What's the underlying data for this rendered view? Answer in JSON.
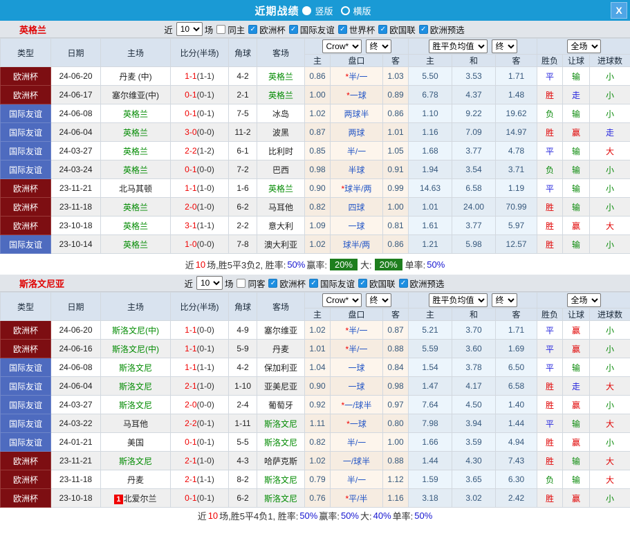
{
  "titlebar": {
    "title": "近期战绩",
    "vertical_label": "竖版",
    "horizontal_label": "横版",
    "close_label": "X",
    "bar_color": "#1a9ad5"
  },
  "columns": {
    "top": [
      "类型",
      "日期",
      "主场",
      "比分(半场)",
      "角球",
      "客场"
    ],
    "selects": {
      "crow": "Crow*",
      "final": "终",
      "avg": "胜平负均值",
      "scope": "全场"
    },
    "sub": [
      "主",
      "盘口",
      "客",
      "主",
      "和",
      "客",
      "胜负",
      "让球",
      "进球数"
    ]
  },
  "colors": {
    "euro_cup_bg": "#7d0e12",
    "friendly_bg": "#4e6bbf",
    "focus_team": "#008a00",
    "win": "#e00000",
    "draw": "#2424dd",
    "lose": "#0a8a0a"
  },
  "sections": [
    {
      "team": "英格兰",
      "filter": {
        "near": "近",
        "count": "10",
        "games": "场",
        "same": "同主",
        "same_checked": false,
        "leagues": [
          {
            "label": "欧洲杯",
            "checked": true
          },
          {
            "label": "国际友谊",
            "checked": true
          },
          {
            "label": "世界杯",
            "checked": true
          },
          {
            "label": "欧国联",
            "checked": true
          },
          {
            "label": "欧洲预选",
            "checked": true
          }
        ]
      },
      "rows": [
        {
          "type": "欧洲杯",
          "cat": "euro",
          "date": "24-06-20",
          "home": "丹麦 (中)",
          "home_focus": false,
          "home_badge": "",
          "score": "1-1",
          "half": "(1-1)",
          "corner": "4-2",
          "away": "英格兰",
          "away_focus": true,
          "c_home": "0.86",
          "star": true,
          "handicap": "半/一",
          "c_away": "1.03",
          "o_home": "5.50",
          "o_draw": "3.53",
          "o_away": "1.71",
          "res": "平",
          "let": "输",
          "goal": "小"
        },
        {
          "type": "欧洲杯",
          "cat": "euro",
          "date": "24-06-17",
          "home": "塞尔维亚(中)",
          "home_focus": false,
          "home_badge": "",
          "score": "0-1",
          "half": "(0-1)",
          "corner": "2-1",
          "away": "英格兰",
          "away_focus": true,
          "c_home": "1.00",
          "star": true,
          "handicap": "一球",
          "c_away": "0.89",
          "o_home": "6.78",
          "o_draw": "4.37",
          "o_away": "1.48",
          "res": "胜",
          "let": "走",
          "goal": "小"
        },
        {
          "type": "国际友谊",
          "cat": "friendly",
          "date": "24-06-08",
          "home": "英格兰",
          "home_focus": true,
          "home_badge": "",
          "score": "0-1",
          "half": "(0-1)",
          "corner": "7-5",
          "away": "冰岛",
          "away_focus": false,
          "c_home": "1.02",
          "star": false,
          "handicap": "两球半",
          "c_away": "0.86",
          "o_home": "1.10",
          "o_draw": "9.22",
          "o_away": "19.62",
          "res": "负",
          "let": "输",
          "goal": "小"
        },
        {
          "type": "国际友谊",
          "cat": "friendly",
          "date": "24-06-04",
          "home": "英格兰",
          "home_focus": true,
          "home_badge": "",
          "score": "3-0",
          "half": "(0-0)",
          "corner": "11-2",
          "away": "波黑",
          "away_focus": false,
          "c_home": "0.87",
          "star": false,
          "handicap": "两球",
          "c_away": "1.01",
          "o_home": "1.16",
          "o_draw": "7.09",
          "o_away": "14.97",
          "res": "胜",
          "let": "赢",
          "goal": "走"
        },
        {
          "type": "国际友谊",
          "cat": "friendly",
          "date": "24-03-27",
          "home": "英格兰",
          "home_focus": true,
          "home_badge": "",
          "score": "2-2",
          "half": "(1-2)",
          "corner": "6-1",
          "away": "比利时",
          "away_focus": false,
          "c_home": "0.85",
          "star": false,
          "handicap": "半/一",
          "c_away": "1.05",
          "o_home": "1.68",
          "o_draw": "3.77",
          "o_away": "4.78",
          "res": "平",
          "let": "输",
          "goal": "大"
        },
        {
          "type": "国际友谊",
          "cat": "friendly",
          "date": "24-03-24",
          "home": "英格兰",
          "home_focus": true,
          "home_badge": "",
          "score": "0-1",
          "half": "(0-0)",
          "corner": "7-2",
          "away": "巴西",
          "away_focus": false,
          "c_home": "0.98",
          "star": false,
          "handicap": "半球",
          "c_away": "0.91",
          "o_home": "1.94",
          "o_draw": "3.54",
          "o_away": "3.71",
          "res": "负",
          "let": "输",
          "goal": "小"
        },
        {
          "type": "欧洲杯",
          "cat": "euro",
          "date": "23-11-21",
          "home": "北马其顿",
          "home_focus": false,
          "home_badge": "",
          "score": "1-1",
          "half": "(1-0)",
          "corner": "1-6",
          "away": "英格兰",
          "away_focus": true,
          "c_home": "0.90",
          "star": true,
          "handicap": "球半/两",
          "c_away": "0.99",
          "o_home": "14.63",
          "o_draw": "6.58",
          "o_away": "1.19",
          "res": "平",
          "let": "输",
          "goal": "小"
        },
        {
          "type": "欧洲杯",
          "cat": "euro",
          "date": "23-11-18",
          "home": "英格兰",
          "home_focus": true,
          "home_badge": "",
          "score": "2-0",
          "half": "(1-0)",
          "corner": "6-2",
          "away": "马耳他",
          "away_focus": false,
          "c_home": "0.82",
          "star": false,
          "handicap": "四球",
          "c_away": "1.00",
          "o_home": "1.01",
          "o_draw": "24.00",
          "o_away": "70.99",
          "res": "胜",
          "let": "输",
          "goal": "小"
        },
        {
          "type": "欧洲杯",
          "cat": "euro",
          "date": "23-10-18",
          "home": "英格兰",
          "home_focus": true,
          "home_badge": "",
          "score": "3-1",
          "half": "(1-1)",
          "corner": "2-2",
          "away": "意大利",
          "away_focus": false,
          "c_home": "1.09",
          "star": false,
          "handicap": "一球",
          "c_away": "0.81",
          "o_home": "1.61",
          "o_draw": "3.77",
          "o_away": "5.97",
          "res": "胜",
          "let": "赢",
          "goal": "大"
        },
        {
          "type": "国际友谊",
          "cat": "friendly",
          "date": "23-10-14",
          "home": "英格兰",
          "home_focus": true,
          "home_badge": "",
          "score": "1-0",
          "half": "(0-0)",
          "corner": "7-8",
          "away": "澳大利亚",
          "away_focus": false,
          "c_home": "1.02",
          "star": false,
          "handicap": "球半/两",
          "c_away": "0.86",
          "o_home": "1.21",
          "o_draw": "5.98",
          "o_away": "12.57",
          "res": "胜",
          "let": "输",
          "goal": "小"
        }
      ],
      "summary": [
        {
          "text": "近"
        },
        {
          "text": "10",
          "style": "red"
        },
        {
          "text": "场,胜5平3负2, 胜率:"
        },
        {
          "text": "50%",
          "style": "blue"
        },
        {
          "text": " 赢率:"
        },
        {
          "text": "20%",
          "style": "greenbox"
        },
        {
          "text": " 大:"
        },
        {
          "text": "20%",
          "style": "greenbox"
        },
        {
          "text": " 单率:"
        },
        {
          "text": "50%",
          "style": "blue"
        }
      ]
    },
    {
      "team": "斯洛文尼亚",
      "filter": {
        "near": "近",
        "count": "10",
        "games": "场",
        "same": "同客",
        "same_checked": false,
        "leagues": [
          {
            "label": "欧洲杯",
            "checked": true
          },
          {
            "label": "国际友谊",
            "checked": true
          },
          {
            "label": "欧国联",
            "checked": true
          },
          {
            "label": "欧洲预选",
            "checked": true
          }
        ]
      },
      "rows": [
        {
          "type": "欧洲杯",
          "cat": "euro",
          "date": "24-06-20",
          "home": "斯洛文尼(中)",
          "home_focus": true,
          "home_badge": "",
          "score": "1-1",
          "half": "(0-0)",
          "corner": "4-9",
          "away": "塞尔维亚",
          "away_focus": false,
          "c_home": "1.02",
          "star": true,
          "handicap": "半/一",
          "c_away": "0.87",
          "o_home": "5.21",
          "o_draw": "3.70",
          "o_away": "1.71",
          "res": "平",
          "let": "赢",
          "goal": "小"
        },
        {
          "type": "欧洲杯",
          "cat": "euro",
          "date": "24-06-16",
          "home": "斯洛文尼(中)",
          "home_focus": true,
          "home_badge": "",
          "score": "1-1",
          "half": "(0-1)",
          "corner": "5-9",
          "away": "丹麦",
          "away_focus": false,
          "c_home": "1.01",
          "star": true,
          "handicap": "半/一",
          "c_away": "0.88",
          "o_home": "5.59",
          "o_draw": "3.60",
          "o_away": "1.69",
          "res": "平",
          "let": "赢",
          "goal": "小"
        },
        {
          "type": "国际友谊",
          "cat": "friendly",
          "date": "24-06-08",
          "home": "斯洛文尼",
          "home_focus": true,
          "home_badge": "",
          "score": "1-1",
          "half": "(1-1)",
          "corner": "4-2",
          "away": "保加利亚",
          "away_focus": false,
          "c_home": "1.04",
          "star": false,
          "handicap": "一球",
          "c_away": "0.84",
          "o_home": "1.54",
          "o_draw": "3.78",
          "o_away": "6.50",
          "res": "平",
          "let": "输",
          "goal": "小"
        },
        {
          "type": "国际友谊",
          "cat": "friendly",
          "date": "24-06-04",
          "home": "斯洛文尼",
          "home_focus": true,
          "home_badge": "",
          "score": "2-1",
          "half": "(1-0)",
          "corner": "1-10",
          "away": "亚美尼亚",
          "away_focus": false,
          "c_home": "0.90",
          "star": false,
          "handicap": "一球",
          "c_away": "0.98",
          "o_home": "1.47",
          "o_draw": "4.17",
          "o_away": "6.58",
          "res": "胜",
          "let": "走",
          "goal": "大"
        },
        {
          "type": "国际友谊",
          "cat": "friendly",
          "date": "24-03-27",
          "home": "斯洛文尼",
          "home_focus": true,
          "home_badge": "",
          "score": "2-0",
          "half": "(0-0)",
          "corner": "2-4",
          "away": "葡萄牙",
          "away_focus": false,
          "c_home": "0.92",
          "star": true,
          "handicap": "一/球半",
          "c_away": "0.97",
          "o_home": "7.64",
          "o_draw": "4.50",
          "o_away": "1.40",
          "res": "胜",
          "let": "赢",
          "goal": "小"
        },
        {
          "type": "国际友谊",
          "cat": "friendly",
          "date": "24-03-22",
          "home": "马耳他",
          "home_focus": false,
          "home_badge": "",
          "score": "2-2",
          "half": "(0-1)",
          "corner": "1-11",
          "away": "斯洛文尼",
          "away_focus": true,
          "c_home": "1.11",
          "star": true,
          "handicap": "一球",
          "c_away": "0.80",
          "o_home": "7.98",
          "o_draw": "3.94",
          "o_away": "1.44",
          "res": "平",
          "let": "输",
          "goal": "大"
        },
        {
          "type": "国际友谊",
          "cat": "friendly",
          "date": "24-01-21",
          "home": "美国",
          "home_focus": false,
          "home_badge": "",
          "score": "0-1",
          "half": "(0-1)",
          "corner": "5-5",
          "away": "斯洛文尼",
          "away_focus": true,
          "c_home": "0.82",
          "star": false,
          "handicap": "半/一",
          "c_away": "1.00",
          "o_home": "1.66",
          "o_draw": "3.59",
          "o_away": "4.94",
          "res": "胜",
          "let": "赢",
          "goal": "小"
        },
        {
          "type": "欧洲杯",
          "cat": "euro",
          "date": "23-11-21",
          "home": "斯洛文尼",
          "home_focus": true,
          "home_badge": "",
          "score": "2-1",
          "half": "(1-0)",
          "corner": "4-3",
          "away": "哈萨克斯",
          "away_focus": false,
          "c_home": "1.02",
          "star": false,
          "handicap": "一/球半",
          "c_away": "0.88",
          "o_home": "1.44",
          "o_draw": "4.30",
          "o_away": "7.43",
          "res": "胜",
          "let": "输",
          "goal": "大"
        },
        {
          "type": "欧洲杯",
          "cat": "euro",
          "date": "23-11-18",
          "home": "丹麦",
          "home_focus": false,
          "home_badge": "",
          "score": "2-1",
          "half": "(1-1)",
          "corner": "8-2",
          "away": "斯洛文尼",
          "away_focus": true,
          "c_home": "0.79",
          "star": false,
          "handicap": "半/一",
          "c_away": "1.12",
          "o_home": "1.59",
          "o_draw": "3.65",
          "o_away": "6.30",
          "res": "负",
          "let": "输",
          "goal": "大"
        },
        {
          "type": "欧洲杯",
          "cat": "euro",
          "date": "23-10-18",
          "home": "北爱尔兰",
          "home_focus": false,
          "home_badge": "1",
          "score": "0-1",
          "half": "(0-1)",
          "corner": "6-2",
          "away": "斯洛文尼",
          "away_focus": true,
          "c_home": "0.76",
          "star": true,
          "handicap": "平/半",
          "c_away": "1.16",
          "o_home": "3.18",
          "o_draw": "3.02",
          "o_away": "2.42",
          "res": "胜",
          "let": "赢",
          "goal": "小"
        }
      ],
      "summary": [
        {
          "text": "近"
        },
        {
          "text": "10",
          "style": "red"
        },
        {
          "text": "场,胜5平4负1, 胜率:"
        },
        {
          "text": "50%",
          "style": "blue"
        },
        {
          "text": " 赢率:"
        },
        {
          "text": "50%",
          "style": "blue"
        },
        {
          "text": " 大:"
        },
        {
          "text": "40%",
          "style": "blue"
        },
        {
          "text": " 单率:"
        },
        {
          "text": "50%",
          "style": "blue"
        }
      ]
    }
  ]
}
